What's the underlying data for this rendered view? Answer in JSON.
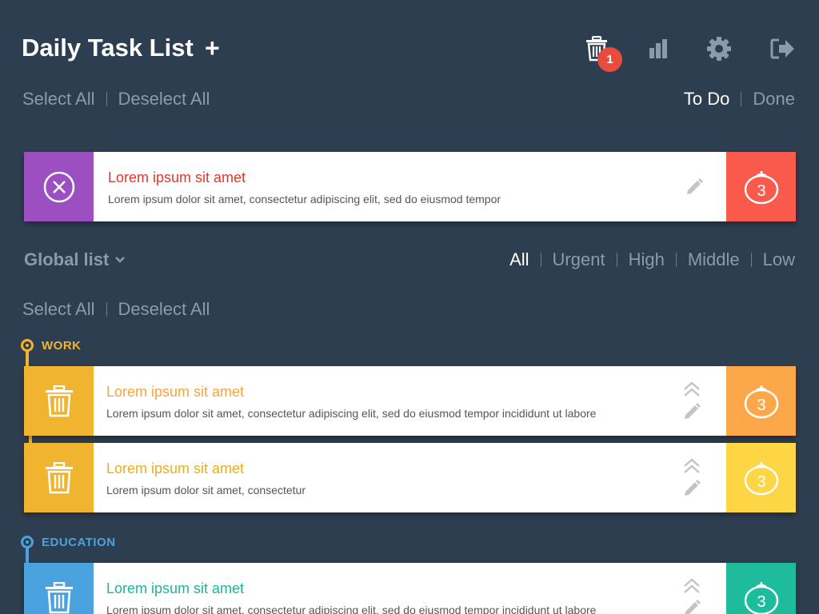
{
  "header": {
    "title": "Daily Task List",
    "add_label": "+",
    "trash_badge": "1"
  },
  "filters_top": {
    "select_all": "Select All",
    "deselect_all": "Deselect All",
    "todo": "To Do",
    "done": "Done"
  },
  "featured_task": {
    "title": "Lorem ipsum sit amet",
    "desc": "Lorem ipsum dolor sit amet, consectetur adipiscing elit, sed do eiusmod tempor",
    "pomodoro": "3",
    "lead_color": "#9b4fc0",
    "tail_color": "#fa5a4b",
    "title_color": "#e0382c"
  },
  "global_list": {
    "label": "Global list",
    "priority": {
      "all": "All",
      "urgent": "Urgent",
      "high": "High",
      "middle": "Middle",
      "low": "Low"
    },
    "select_all": "Select All",
    "deselect_all": "Deselect All"
  },
  "categories": {
    "work": {
      "label": "WORK",
      "color": "#f1b42f",
      "tasks": [
        {
          "title": "Lorem ipsum sit amet",
          "desc": "Lorem ipsum dolor sit amet, consectetur adipiscing elit, sed do eiusmod tempor incididunt ut labore",
          "pomodoro": "3",
          "title_color": "#f7a43a",
          "tail_color": "#fca84a"
        },
        {
          "title": "Lorem ipsum sit amet",
          "desc": "Lorem ipsum dolor sit amet, consectetur",
          "pomodoro": "3",
          "title_color": "#e9ae1c",
          "tail_color": "#fcd645"
        }
      ]
    },
    "education": {
      "label": "EDUCATION",
      "color": "#4aa3df",
      "tasks": [
        {
          "title": "Lorem ipsum sit amet",
          "desc": "Lorem ipsum dolor sit amet, consectetur adipiscing elit, sed do eiusmod tempor incididunt ut labore",
          "pomodoro": "3",
          "title_color": "#1fb49a",
          "tail_color": "#1cbc9c"
        }
      ]
    }
  },
  "icons": {
    "trash": "trash-icon",
    "stats": "bar-chart-icon",
    "settings": "gear-icon",
    "logout": "logout-icon",
    "close": "close-circle-icon",
    "edit": "pencil-icon",
    "priority": "chevrons-up-icon",
    "pomodoro": "tomato-icon",
    "dropdown": "chevron-down-icon"
  }
}
